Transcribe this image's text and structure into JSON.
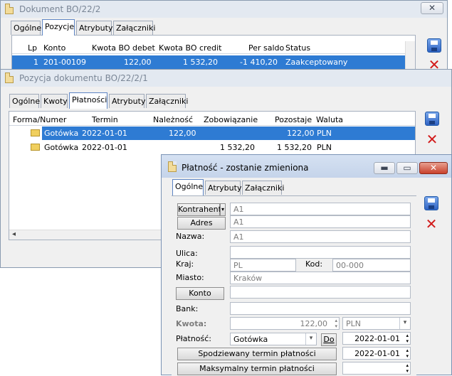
{
  "win1": {
    "title": "Dokument BO/22/2",
    "close": "✕",
    "tabs": [
      "Ogólne",
      "Pozycje",
      "Atrybuty",
      "Załączniki"
    ],
    "headers": [
      "Lp",
      "Konto",
      "Kwota BO debet",
      "Kwota BO credit",
      "Per saldo",
      "Status"
    ],
    "row": [
      "1",
      "201-00109",
      "122,00",
      "1 532,20",
      "-1 410,20",
      "Zaakceptowany"
    ]
  },
  "win2": {
    "title": "Pozycja dokumentu BO/22/2/1",
    "tabs": [
      "Ogólne",
      "Kwoty",
      "Płatności",
      "Atrybuty",
      "Załączniki"
    ],
    "headers": [
      "Forma/Numer",
      "Termin",
      "Należność",
      "Zobowiązanie",
      "Pozostaje",
      "Waluta"
    ],
    "rows": [
      [
        "Gotówka",
        "2022-01-01",
        "122,00",
        "",
        "122,00",
        "PLN"
      ],
      [
        "Gotówka",
        "2022-01-01",
        "",
        "1 532,20",
        "1 532,20",
        "PLN"
      ]
    ]
  },
  "win3": {
    "title": "Płatność - zostanie zmieniona",
    "tabs": [
      "Ogólne",
      "Atrybuty",
      "Załączniki"
    ],
    "kontrahent_btn": "Kontrahent",
    "adres_btn": "Adres",
    "kontrahent_val": "A1",
    "adres_val": "A1",
    "nazwa_lbl": "Nazwa:",
    "nazwa_val": "A1",
    "ulica_lbl": "Ulica:",
    "ulica_val": "",
    "kraj_lbl": "Kraj:",
    "kraj_val": "PL",
    "kod_lbl": "Kod:",
    "kod_val": "00-000",
    "miasto_lbl": "Miasto:",
    "miasto_val": "Kraków",
    "konto_btn": "Konto",
    "konto_val": "",
    "bank_lbl": "Bank:",
    "bank_val": "",
    "kwota_lbl": "Kwota:",
    "kwota_val": "122,00",
    "waluta_val": "PLN",
    "platnosc_lbl": "Płatność:",
    "platnosc_val": "Gotówka",
    "do_btn": "Do",
    "termin_val": "2022-01-01",
    "spodz_btn": "Spodziewany termin płatności",
    "spodz_val": "2022-01-01",
    "maks_btn": "Maksymalny termin płatności",
    "maks_val": ""
  }
}
